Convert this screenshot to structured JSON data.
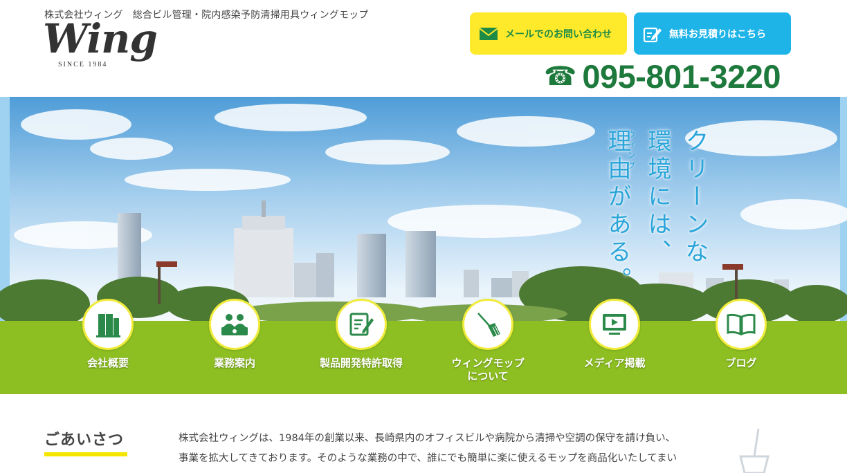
{
  "header": {
    "tagline": "株式会社ウィング　総合ビル管理・院内感染予防清掃用具ウィングモップ",
    "logo_word": "Wing",
    "logo_since": "SINCE 1984",
    "mail_button": "メールでのお問い合わせ",
    "estimate_button": "無料お見積りはこちら",
    "phone_number": "095-801-3220",
    "phone_icon": "telephone-icon"
  },
  "hero": {
    "line1": "クリーンな",
    "line2": "環境には、",
    "line3": "理由がある。",
    "ruby": "ウィング"
  },
  "nav": {
    "items": [
      {
        "label": "会社概要",
        "icon": "building-icon"
      },
      {
        "label": "業務案内",
        "icon": "people-meeting-icon"
      },
      {
        "label": "製品開発特許取得",
        "icon": "document-pen-icon"
      },
      {
        "label": "ウィングモップ\nについて",
        "icon": "broom-icon"
      },
      {
        "label": "メディア掲載",
        "icon": "tv-icon"
      },
      {
        "label": "ブログ",
        "icon": "book-icon"
      }
    ]
  },
  "greeting": {
    "title": "ごあいさつ",
    "body": "株式会社ウィングは、1984年の創業以来、長崎県内のオフィスビルや病院から清掃や空調の保守を請け負い、事業を拡大してきております。そのような業務の中で、誰にでも簡単に楽に使えるモップを商品化いたしてまいりました。"
  },
  "colors": {
    "green_bar": "#8dbf22",
    "yellow_button": "#ffe92b",
    "blue_button": "#1fb4e8",
    "phone_green": "#1e7a3c",
    "hero_text": "#2aa5d9"
  }
}
